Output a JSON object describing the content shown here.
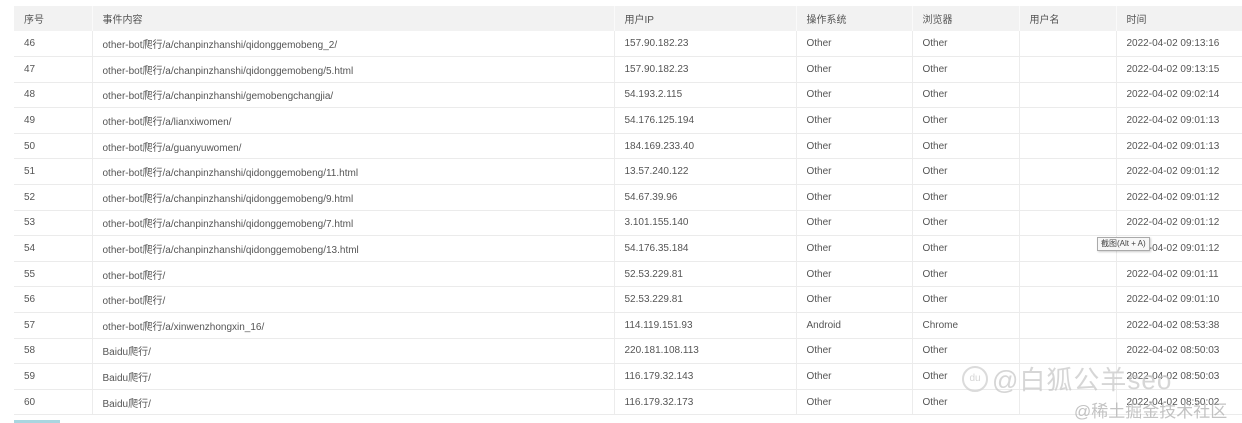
{
  "columns": [
    "序号",
    "事件内容",
    "用户IP",
    "操作系统",
    "浏览器",
    "用户名",
    "时间"
  ],
  "rows": [
    [
      "46",
      "other-bot爬行/a/chanpinzhanshi/qidonggemobeng_2/",
      "157.90.182.23",
      "Other",
      "Other",
      "",
      "2022-04-02 09:13:16"
    ],
    [
      "47",
      "other-bot爬行/a/chanpinzhanshi/qidonggemobeng/5.html",
      "157.90.182.23",
      "Other",
      "Other",
      "",
      "2022-04-02 09:13:15"
    ],
    [
      "48",
      "other-bot爬行/a/chanpinzhanshi/gemobengchangjia/",
      "54.193.2.115",
      "Other",
      "Other",
      "",
      "2022-04-02 09:02:14"
    ],
    [
      "49",
      "other-bot爬行/a/lianxiwomen/",
      "54.176.125.194",
      "Other",
      "Other",
      "",
      "2022-04-02 09:01:13"
    ],
    [
      "50",
      "other-bot爬行/a/guanyuwomen/",
      "184.169.233.40",
      "Other",
      "Other",
      "",
      "2022-04-02 09:01:13"
    ],
    [
      "51",
      "other-bot爬行/a/chanpinzhanshi/qidonggemobeng/11.html",
      "13.57.240.122",
      "Other",
      "Other",
      "",
      "2022-04-02 09:01:12"
    ],
    [
      "52",
      "other-bot爬行/a/chanpinzhanshi/qidonggemobeng/9.html",
      "54.67.39.96",
      "Other",
      "Other",
      "",
      "2022-04-02 09:01:12"
    ],
    [
      "53",
      "other-bot爬行/a/chanpinzhanshi/qidonggemobeng/7.html",
      "3.101.155.140",
      "Other",
      "Other",
      "",
      "2022-04-02 09:01:12"
    ],
    [
      "54",
      "other-bot爬行/a/chanpinzhanshi/qidonggemobeng/13.html",
      "54.176.35.184",
      "Other",
      "Other",
      "",
      "2022-04-02 09:01:12"
    ],
    [
      "55",
      "other-bot爬行/",
      "52.53.229.81",
      "Other",
      "Other",
      "",
      "2022-04-02 09:01:11"
    ],
    [
      "56",
      "other-bot爬行/",
      "52.53.229.81",
      "Other",
      "Other",
      "",
      "2022-04-02 09:01:10"
    ],
    [
      "57",
      "other-bot爬行/a/xinwenzhongxin_16/",
      "114.119.151.93",
      "Android",
      "Chrome",
      "",
      "2022-04-02 08:53:38"
    ],
    [
      "58",
      "Baidu爬行/",
      "220.181.108.113",
      "Other",
      "Other",
      "",
      "2022-04-02 08:50:03"
    ],
    [
      "59",
      "Baidu爬行/",
      "116.179.32.143",
      "Other",
      "Other",
      "",
      "2022-04-02 08:50:03"
    ],
    [
      "60",
      "Baidu爬行/",
      "116.179.32.173",
      "Other",
      "Other",
      "",
      "2022-04-02 08:50:02"
    ]
  ],
  "tooltip": "截图(Alt + A)",
  "watermark": {
    "logo": "du",
    "line1": "@白狐公羊seo",
    "line2": "@稀土掘金技术社区"
  }
}
